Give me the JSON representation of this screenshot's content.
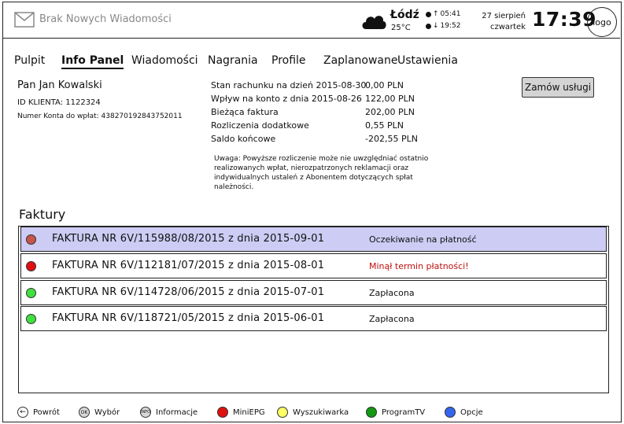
{
  "header": {
    "mail_label": "Brak Nowych Wiadomości",
    "weather": {
      "city": "Łódź",
      "temp": "25°C"
    },
    "sunrise": "05:41",
    "sunset": "19:52",
    "date_line1": "27 sierpień",
    "date_line2": "czwartek",
    "time": "17:39",
    "logo": "logo"
  },
  "nav": {
    "tabs": [
      {
        "label": "Pulpit"
      },
      {
        "label": "Info Panel"
      },
      {
        "label": "Wiadomości"
      },
      {
        "label": "Nagrania"
      },
      {
        "label": "Profile"
      },
      {
        "label": "Zaplanowane"
      },
      {
        "label": "Ustawienia"
      }
    ],
    "active": "Info Panel"
  },
  "client": {
    "name": "Pan Jan Kowalski",
    "id_line": "ID KLIENTA: 1122324",
    "account_line": "Numer Konta do wpłat: 438270192843752011"
  },
  "summary": {
    "rows": [
      {
        "label": "Stan rachunku na dzień 2015-08-30",
        "value": "0,00 PLN"
      },
      {
        "label": "Wpływ na konto z dnia 2015-08-26",
        "value": "122,00 PLN"
      },
      {
        "label": "Bieżąca faktura",
        "value": "202,00 PLN"
      },
      {
        "label": "Rozliczenia dodatkowe",
        "value": "0,55 PLN"
      },
      {
        "label": "Saldo końcowe",
        "value": "-202,55 PLN"
      }
    ],
    "note": "Uwaga: Powyższe rozliczenie może nie uwzględniać ostatnio realizowanych wpłat, nierozpatrzonych reklamacji oraz indywidualnych ustaleń z Abonentem dotyczących spłat należności."
  },
  "order_button": "Zamów usługi",
  "invoices": {
    "title": "Faktury",
    "items": [
      {
        "name": "FAKTURA NR 6V/115988/08/2015 z dnia 2015-09-01",
        "status": "Oczekiwanie na płatność",
        "dot_color": "#c8554a",
        "status_color": "#111111"
      },
      {
        "name": "FAKTURA NR 6V/112181/07/2015 z dnia 2015-08-01",
        "status": "Minął termin płatności!",
        "dot_color": "#e01010",
        "status_color": "#c01010"
      },
      {
        "name": "FAKTURA NR 6V/114728/06/2015 z dnia 2015-07-01",
        "status": "Zapłacona",
        "dot_color": "#3ee03e",
        "status_color": "#111111"
      },
      {
        "name": "FAKTURA NR 6V/118721/05/2015 z dnia 2015-06-01",
        "status": "Zapłacona",
        "dot_color": "#3ee03e",
        "status_color": "#111111"
      }
    ]
  },
  "footer": {
    "items": [
      {
        "label": "Powrót",
        "icon": "arrow-left-icon",
        "badge": "←",
        "color": "#ffffff"
      },
      {
        "label": "Wybór",
        "icon": "ok-icon",
        "badge": "OK",
        "color": "#d8d8d8"
      },
      {
        "label": "Informacje",
        "icon": "info-icon",
        "badge": "INFO",
        "color": "#d8d8d8"
      },
      {
        "label": "MiniEPG",
        "icon": "red-button-icon",
        "badge": "",
        "color": "#e01010"
      },
      {
        "label": "Wyszukiwarka",
        "icon": "yellow-button-icon",
        "badge": "",
        "color": "#ffff66"
      },
      {
        "label": "ProgramTV",
        "icon": "green-button-icon",
        "badge": "",
        "color": "#119911"
      },
      {
        "label": "Opcje",
        "icon": "blue-button-icon",
        "badge": "",
        "color": "#3366ee"
      }
    ]
  }
}
